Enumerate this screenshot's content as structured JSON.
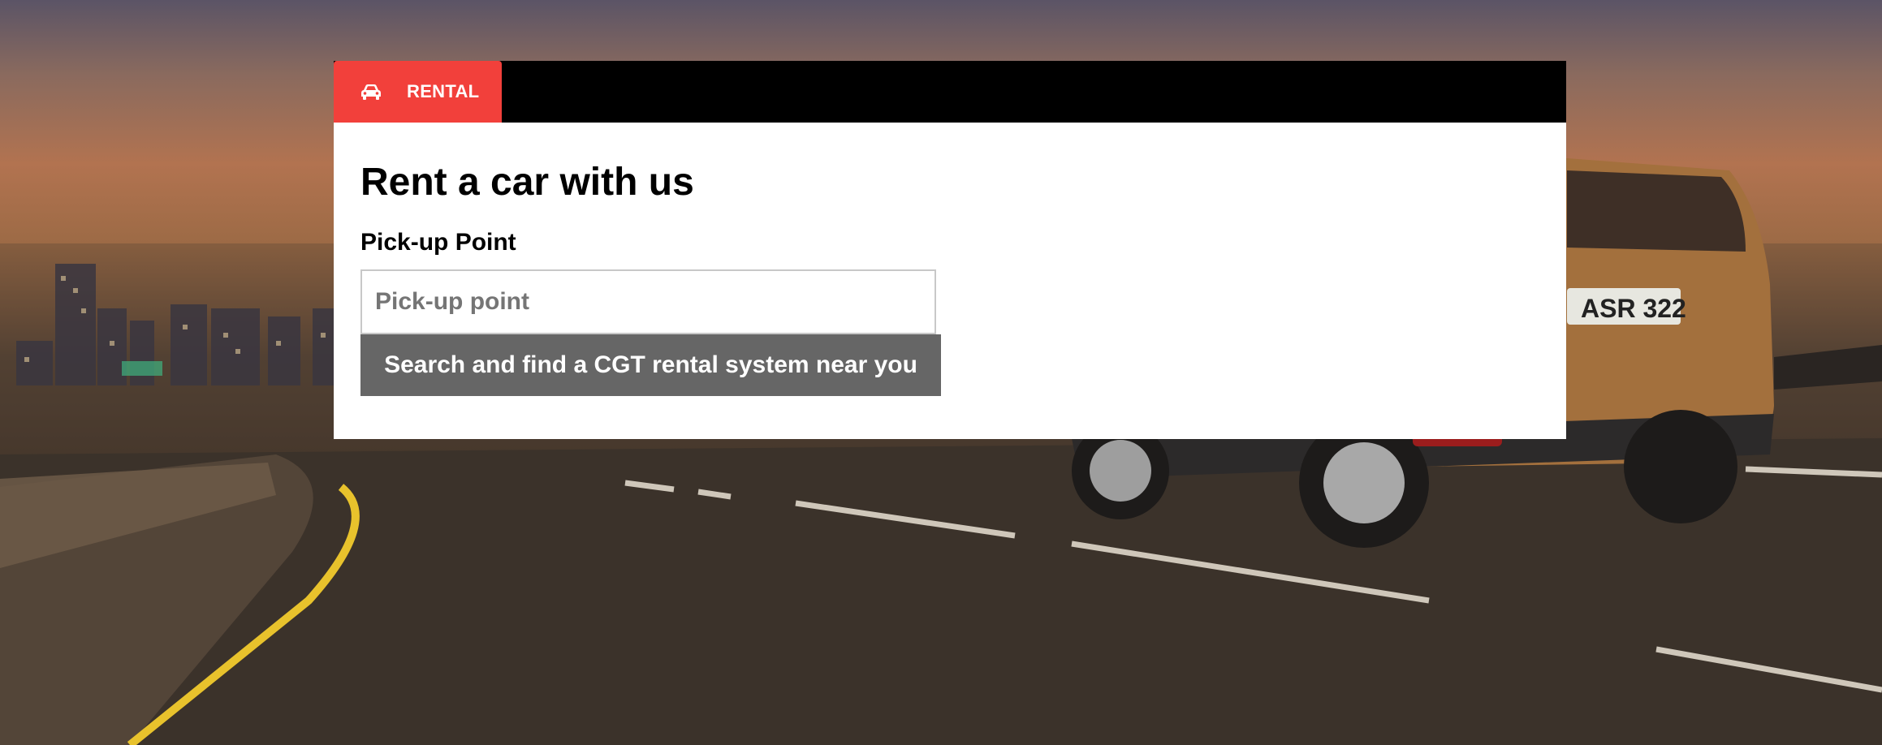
{
  "tabs": [
    {
      "label": "RENTAL",
      "icon": "car-icon",
      "active": true
    }
  ],
  "form": {
    "title": "Rent a car with us",
    "pickup_label": "Pick-up Point",
    "pickup_placeholder": "Pick-up point",
    "pickup_value": "",
    "search_button_label": "Search and find a CGT rental system near you"
  },
  "background": {
    "license_plate": "ASR 322"
  },
  "colors": {
    "tab_active": "#f2403b",
    "tab_bar": "#000000",
    "button": "#666666",
    "panel": "#ffffff"
  }
}
